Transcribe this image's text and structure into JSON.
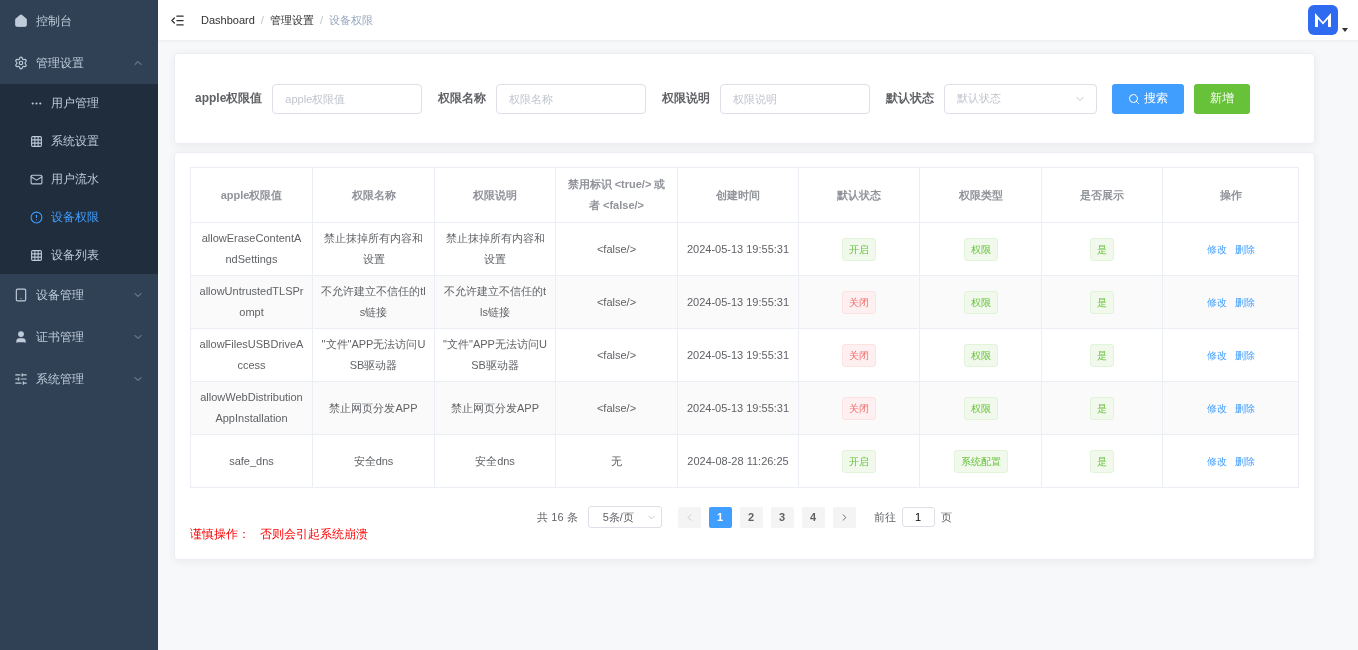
{
  "sidebar": {
    "items": [
      {
        "label": "控制台",
        "selected": false
      },
      {
        "label": "管理设置",
        "expanded": true,
        "selected": false,
        "children": [
          {
            "label": "用户管理",
            "selected": false
          },
          {
            "label": "系统设置",
            "selected": false
          },
          {
            "label": "用户流水",
            "selected": false
          },
          {
            "label": "设备权限",
            "selected": true
          },
          {
            "label": "设备列表",
            "selected": false
          }
        ]
      },
      {
        "label": "设备管理",
        "expanded": false,
        "selected": false
      },
      {
        "label": "证书管理",
        "expanded": false,
        "selected": false
      },
      {
        "label": "系统管理",
        "expanded": false,
        "selected": false
      }
    ]
  },
  "breadcrumb": [
    {
      "label": "Dashboard",
      "current": false
    },
    {
      "separator": "/",
      "label": "管理设置",
      "current": false
    },
    {
      "separator": "/",
      "label": "设备权限",
      "current": true
    }
  ],
  "filters": [
    {
      "kind": "input",
      "label": "apple权限值",
      "placeholder": "apple权限值"
    },
    {
      "kind": "input",
      "label": "权限名称",
      "placeholder": "权限名称"
    },
    {
      "kind": "input",
      "label": "权限说明",
      "placeholder": "权限说明"
    },
    {
      "kind": "select",
      "label": "默认状态",
      "placeholder": "默认状态"
    }
  ],
  "buttons": [
    {
      "kind": "primary",
      "label": "搜索"
    },
    {
      "kind": "success",
      "label": "新增"
    }
  ],
  "table": {
    "columns": [
      "apple权限值",
      "权限名称",
      "权限说明",
      "禁用标识 <true/> 或者 <false/>",
      "创建时间",
      "默认状态",
      "权限类型",
      "是否展示",
      "操作"
    ],
    "rows": [
      {
        "value": "allowEraseContentAndSettings",
        "name": "禁止抹掉所有内容和设置",
        "description": "禁止抹掉所有内容和设置",
        "flag": "<false/>",
        "created": "2024-05-13 19:55:31",
        "status": {
          "text": "开启",
          "on": true
        },
        "type": "权限",
        "shown": "是",
        "actions": [
          "修改",
          "删除"
        ]
      },
      {
        "value": "allowUntrustedTLSPrompt",
        "name": "不允许建立不信任的tls链接",
        "description": "不允许建立不信任的tls链接",
        "flag": "<false/>",
        "created": "2024-05-13 19:55:31",
        "status": {
          "text": "关闭",
          "on": false
        },
        "type": "权限",
        "shown": "是",
        "actions": [
          "修改",
          "删除"
        ]
      },
      {
        "value": "allowFilesUSBDriveAccess",
        "name": "\"文件\"APP无法访问USB驱动器",
        "description": "\"文件\"APP无法访问USB驱动器",
        "flag": "<false/>",
        "created": "2024-05-13 19:55:31",
        "status": {
          "text": "关闭",
          "on": false
        },
        "type": "权限",
        "shown": "是",
        "actions": [
          "修改",
          "删除"
        ]
      },
      {
        "value": "allowWebDistributionAppInstallation",
        "name": "禁止网页分发APP",
        "description": "禁止网页分发APP",
        "flag": "<false/>",
        "created": "2024-05-13 19:55:31",
        "status": {
          "text": "关闭",
          "on": false
        },
        "type": "权限",
        "shown": "是",
        "actions": [
          "修改",
          "删除"
        ]
      },
      {
        "value": "safe_dns",
        "name": "安全dns",
        "description": "安全dns",
        "flag": "无",
        "created": "2024-08-28 11:26:25",
        "status": {
          "text": "开启",
          "on": true
        },
        "type": "系统配置",
        "shown": "是",
        "actions": [
          "修改",
          "删除"
        ]
      }
    ]
  },
  "pagination": {
    "total": "共 16 条",
    "page_size": "5条/页",
    "prev_disabled": true,
    "pages": [
      {
        "label": "1",
        "selected": true
      },
      {
        "label": "2",
        "selected": false
      },
      {
        "label": "3",
        "selected": false
      },
      {
        "label": "4",
        "selected": false
      }
    ],
    "goto_label": "前往",
    "goto_value": "1",
    "goto_suffix": "页"
  },
  "warning": {
    "label": "谨慎操作：",
    "text": "否则会引起系统崩溃"
  }
}
